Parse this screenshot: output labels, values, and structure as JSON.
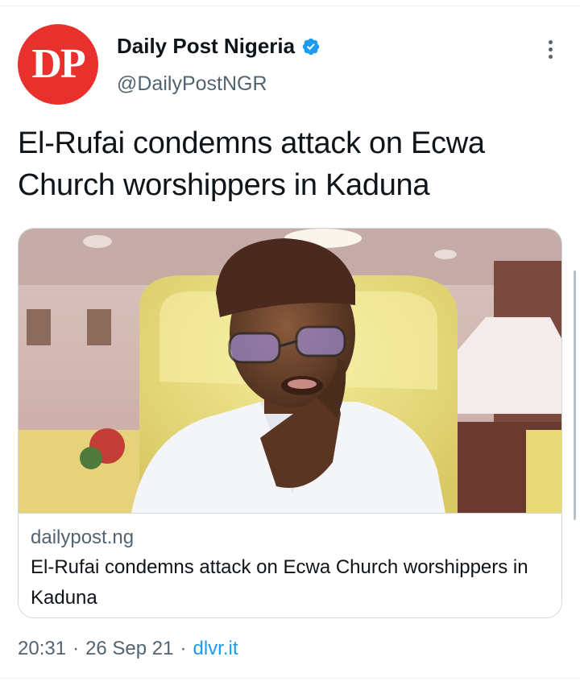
{
  "tweet": {
    "author": {
      "avatar_text": "DP",
      "display_name": "Daily Post Nigeria",
      "handle": "@DailyPostNGR",
      "verified": true
    },
    "text": "El-Rufai condemns attack on Ecwa Church worshippers in Kaduna",
    "card": {
      "domain": "dailypost.ng",
      "title": "El-Rufai condemns attack on Ecwa Church worshippers in Kaduna"
    },
    "meta": {
      "time": "20:31",
      "separator": "·",
      "date": "26 Sep 21",
      "source": "dlvr.it"
    }
  },
  "icons": {
    "verified": "verified-badge-icon",
    "more": "more-options-icon"
  },
  "colors": {
    "avatar_bg": "#e8302d",
    "verified_blue": "#1d9bf0",
    "link_blue": "#1d9bf0",
    "secondary_text": "#536471",
    "primary_text": "#0f1419",
    "border": "#cfd9de"
  }
}
